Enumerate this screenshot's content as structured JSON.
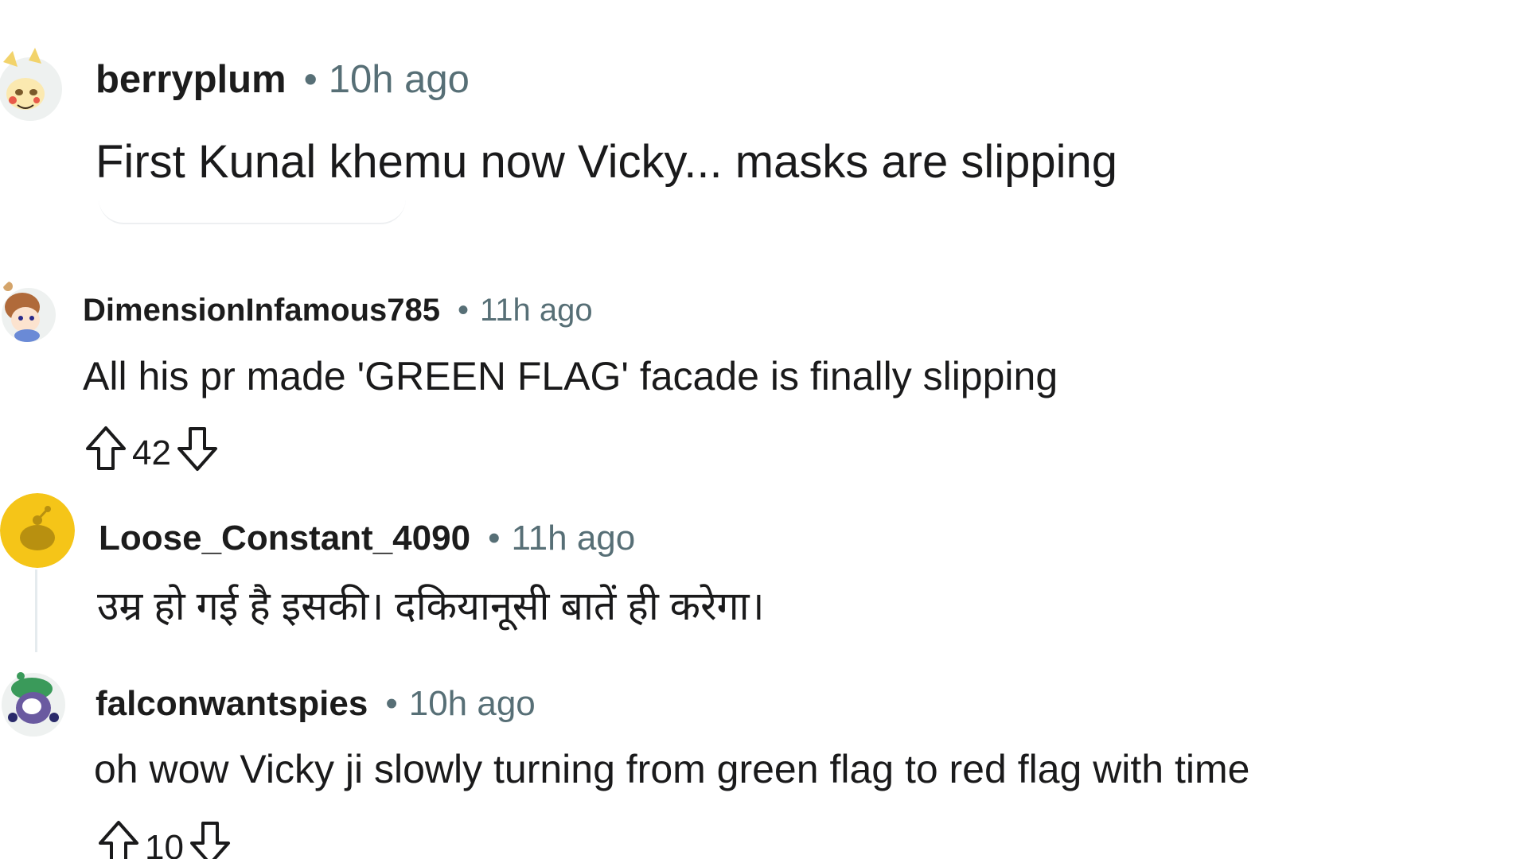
{
  "comments": [
    {
      "username": "berryplum",
      "separator": "•",
      "time": "10h ago",
      "text": "First Kunal khemu now Vicky... masks are slipping"
    },
    {
      "username": "DimensionInfamous785",
      "separator": "•",
      "time": "11h ago",
      "text": "All his pr made 'GREEN FLAG' facade is finally slipping",
      "score": "42"
    },
    {
      "username": "Loose_Constant_4090",
      "separator": "•",
      "time": "11h ago",
      "text": "उम्र हो गई है इसकी। दकियानूसी बातें ही करेगा।"
    },
    {
      "username": "falconwantspies",
      "separator": "•",
      "time": "10h ago",
      "text": "oh wow Vicky ji slowly turning from green flag to red flag with time",
      "score": "10"
    }
  ],
  "icons": {
    "upvote": "arrow-up-outline-icon",
    "downvote": "arrow-down-outline-icon"
  },
  "colors": {
    "text": "#1a1a1b",
    "meta": "#576f76",
    "avatar_yellow": "#f5c518"
  }
}
